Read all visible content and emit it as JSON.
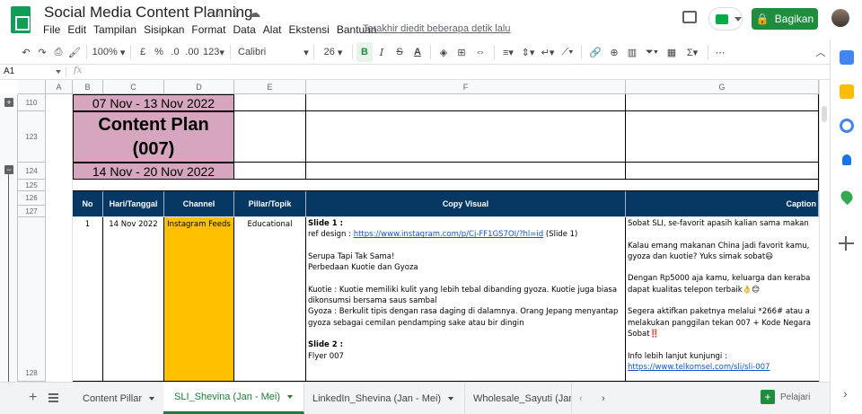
{
  "app": {
    "title": "Social Media Content Planning",
    "menu": [
      "File",
      "Edit",
      "Tampilan",
      "Sisipkan",
      "Format",
      "Data",
      "Alat",
      "Ekstensi",
      "Bantuan"
    ],
    "last_edit": "Terakhir diedit beberapa detik lalu",
    "share_label": "Bagikan",
    "title_icons": [
      "star-icon",
      "move-icon",
      "cloud-status-icon"
    ]
  },
  "toolbar": {
    "zoom": "100%",
    "currency": "£",
    "percent": "%",
    "dec_decrease": ".0",
    "dec_increase": ".00",
    "format_more": "123",
    "font": "Calibri",
    "font_size": "26",
    "bold": "B",
    "italic": "I",
    "strike": "S",
    "text_color": "A"
  },
  "formula_bar": {
    "cell_ref": "A1",
    "fx": "fx"
  },
  "columns": [
    "A",
    "B",
    "C",
    "D",
    "E",
    "F",
    "G"
  ],
  "rows": [
    "110",
    "123",
    "124",
    "125",
    "126",
    "127",
    "128"
  ],
  "sheet": {
    "week1": "07 Nov - 13 Nov 2022",
    "content_plan": "Content Plan",
    "plan_no": "(007)",
    "week2": "14 Nov - 20 Nov 2022",
    "headers": [
      "No",
      "Hari/Tanggal",
      "Channel",
      "Pillar/Topik",
      "Copy Visual",
      "Caption"
    ],
    "row1": {
      "no": "1",
      "date": "14 Nov 2022",
      "channel": "Instagram Feeds",
      "pillar": "Educational",
      "slide1_label": "Slide 1 :",
      "ref_prefix": "ref design : ",
      "ref_link": "https://www.instagram.com/p/Cj-FF1GS7OI/?hl=id",
      "ref_suffix": " (Slide 1)",
      "line_serupa": "Serupa Tapi Tak Sama!",
      "line_perbedaan": "Perbedaan Kuotie dan Gyoza",
      "line_kuotie1": "Kuotie : Kuotie memiliki kulit yang lebih tebal dibanding gyoza. Kuotie juga biasa",
      "line_kuotie2": "dikonsumsi bersama saus sambal",
      "line_gyoza1": "Gyoza : Berkulit tipis dengan rasa daging di dalamnya. Orang Jepang menyantap",
      "line_gyoza2": "gyoza sebagai cemilan pendamping sake atau bir dingin",
      "slide2_label": "Slide 2 :",
      "flyer": "Flyer 007",
      "caption_lines": [
        "Sobat SLI, se-favorit apasih kalian sama makan",
        "",
        "Kalau emang makanan China jadi favorit kamu,",
        "gyoza dan kuotie? Yuks simak sobat😃",
        "",
        "Dengan Rp5000 aja kamu, keluarga dan keraba",
        "dapat kualitas telepon terbaik👌😊",
        "",
        "Segera aktifkan paketnya melalui *266# atau a",
        "melakukan panggilan tekan 007 + Kode Negara",
        "Sobat‼️",
        "",
        "Info lebih lanjut kunjungi :",
        "https://www.telkomsel.com/sli/sli-007"
      ]
    }
  },
  "tabs": [
    {
      "label": "Content Pillar",
      "active": false
    },
    {
      "label": "SLI_Shevina (Jan - Mei)",
      "active": true
    },
    {
      "label": "LinkedIn_Shevina (Jan - Mei)",
      "active": false
    },
    {
      "label": "Wholesale_Sayuti (Jan",
      "active": false
    }
  ],
  "explore_label": "Pelajari",
  "colors": {
    "brand_green": "#1e8e3e",
    "header_navy": "#073763",
    "pink": "#d5a6bd",
    "channel_yellow": "#ffc000"
  }
}
